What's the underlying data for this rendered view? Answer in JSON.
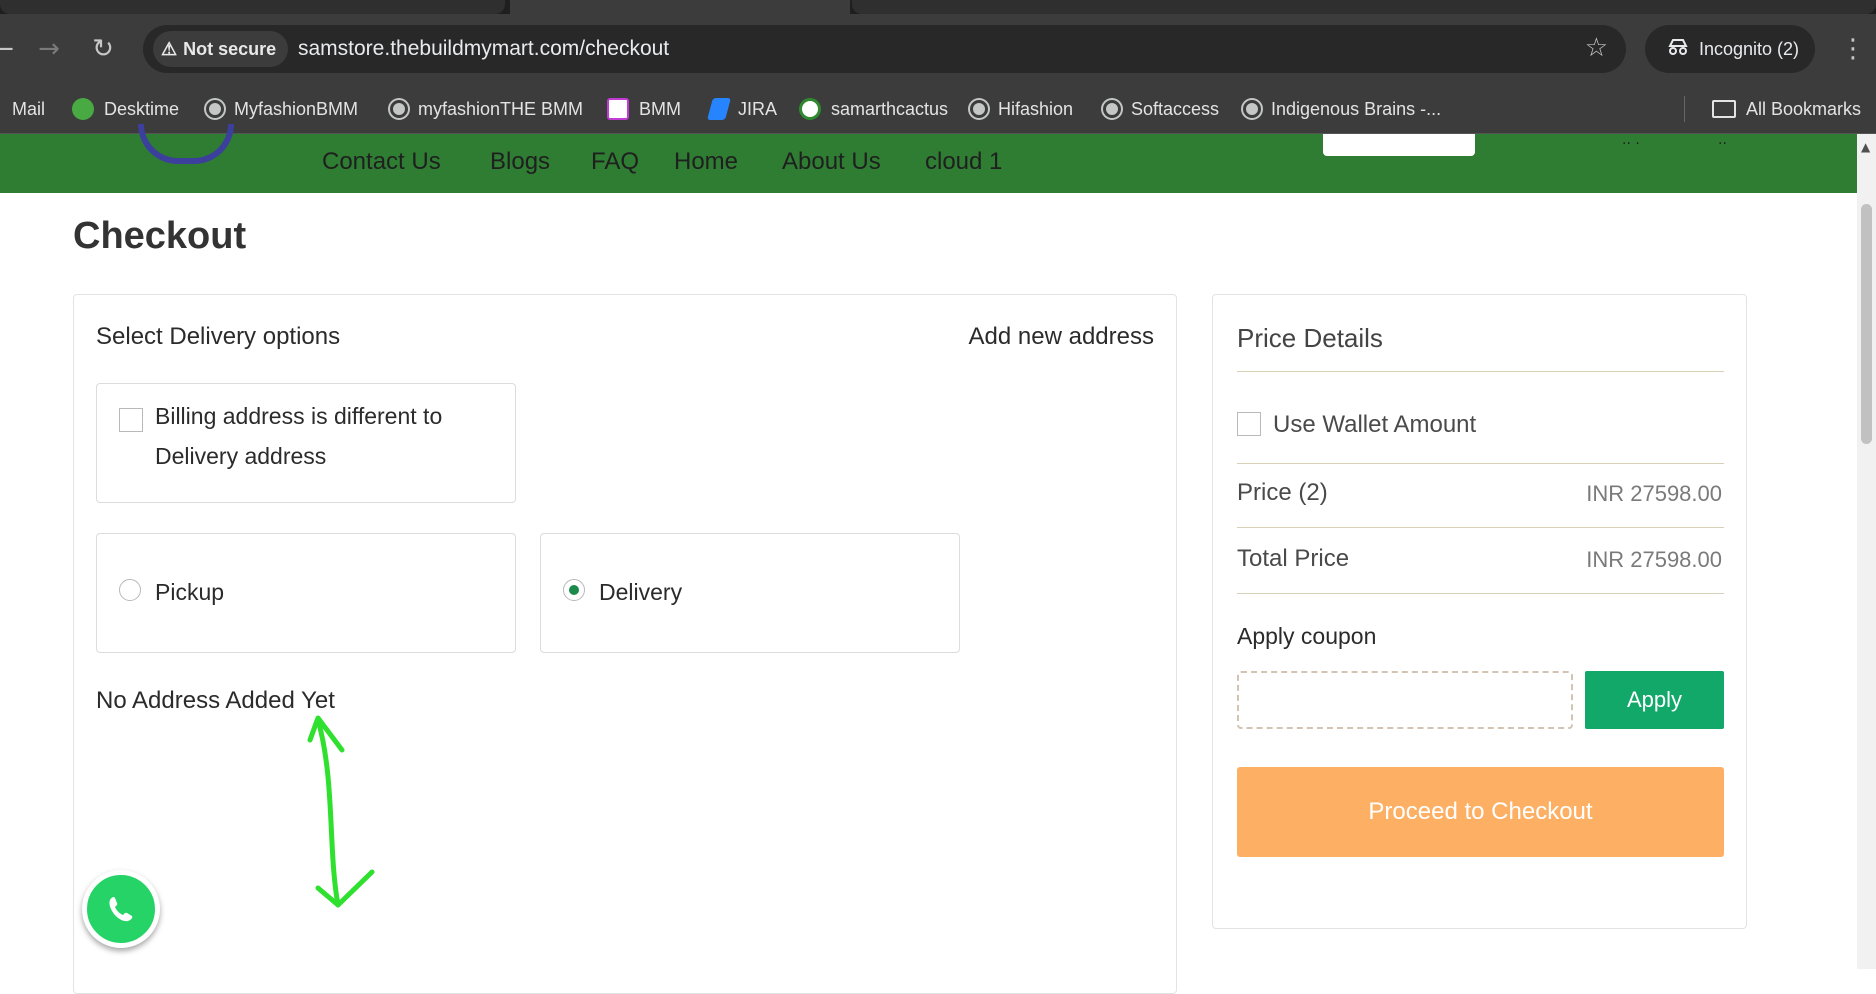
{
  "browser": {
    "security_label": "Not secure",
    "url": "samstore.thebuildmymart.com/checkout",
    "incognito_label": "Incognito (2)",
    "bookmarks": [
      {
        "label": "Mail",
        "icon": "mail-icon"
      },
      {
        "label": "Desktime",
        "icon": "desktime-icon"
      },
      {
        "label": "MyfashionBMM",
        "icon": "globe-icon"
      },
      {
        "label": "myfashionTHE BMM",
        "icon": "globe-icon"
      },
      {
        "label": "BMM",
        "icon": "bmm-icon"
      },
      {
        "label": "JIRA",
        "icon": "jira-icon"
      },
      {
        "label": "samarthcactus",
        "icon": "cactus-icon"
      },
      {
        "label": "Hifashion",
        "icon": "globe-icon"
      },
      {
        "label": "Softaccess",
        "icon": "globe-icon"
      },
      {
        "label": "Indigenous Brains -...",
        "icon": "globe-icon"
      }
    ],
    "all_bookmarks_label": "All Bookmarks"
  },
  "site_nav": {
    "links": [
      "Contact Us",
      "Blogs",
      "FAQ",
      "Home",
      "About Us",
      "cloud 1"
    ],
    "color": "#2e7d32"
  },
  "page": {
    "title": "Checkout"
  },
  "delivery": {
    "section_title": "Select Delivery options",
    "add_address_label": "Add new address",
    "billing_checkbox_label_line1": "Billing address is different to",
    "billing_checkbox_label_line2": "Delivery address",
    "billing_checked": false,
    "options": [
      {
        "label": "Pickup",
        "selected": false
      },
      {
        "label": "Delivery",
        "selected": true
      }
    ],
    "no_address_text": "No Address Added Yet"
  },
  "price_details": {
    "title": "Price Details",
    "wallet_label": "Use Wallet Amount",
    "wallet_checked": false,
    "rows": [
      {
        "label": "Price (2)",
        "value": "INR 27598.00"
      },
      {
        "label": "Total Price",
        "value": "INR 27598.00"
      }
    ],
    "coupon_title": "Apply coupon",
    "coupon_value": "",
    "apply_label": "Apply",
    "checkout_label": "Proceed to Checkout",
    "accent_green": "#12a86a",
    "checkout_color": "#fdb064"
  }
}
